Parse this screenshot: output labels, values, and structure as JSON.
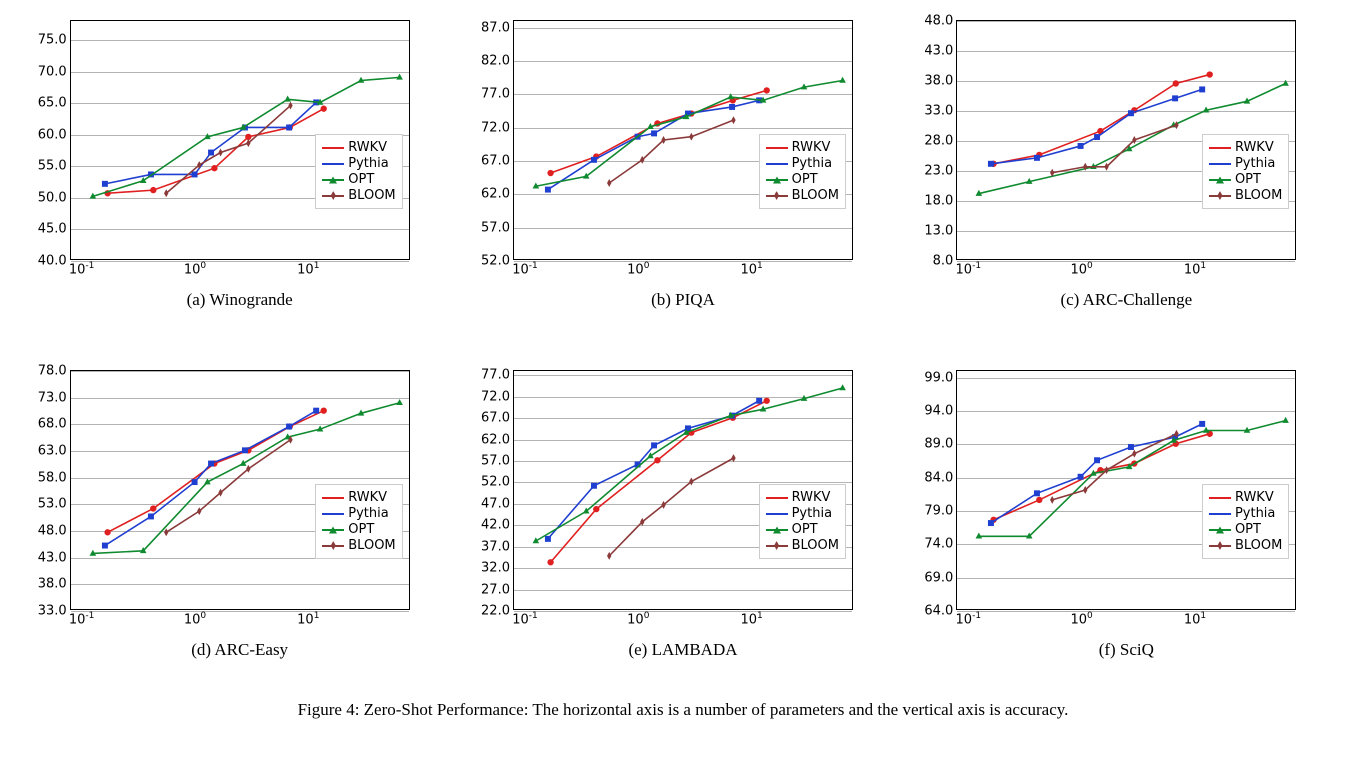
{
  "caption": "Figure 4: Zero-Shot Performance: The horizontal axis is a number of parameters and the vertical axis is accuracy.",
  "colors": {
    "RWKV": "#e02020",
    "Pythia": "#1f3fd0",
    "OPT": "#0f8a2f",
    "BLOOM": "#8b3a3a"
  },
  "markers": {
    "RWKV": "circle",
    "Pythia": "square",
    "OPT": "triangle",
    "BLOOM": "thin-diamond"
  },
  "legend_order": [
    "RWKV",
    "Pythia",
    "OPT",
    "BLOOM"
  ],
  "x_ticks_log": [
    -1,
    0,
    1
  ],
  "chart_data": [
    {
      "id": "winogrande",
      "subcap": "(a) Winogrande",
      "type": "line",
      "xscale": "log",
      "xlim": [
        0.08,
        80
      ],
      "ylim": [
        40,
        78
      ],
      "yticks": [
        40,
        45,
        50,
        55,
        60,
        65,
        70,
        75
      ],
      "legend_pos": "right-mid",
      "series": {
        "RWKV": {
          "x": [
            0.169,
            0.43,
            1.5,
            3,
            7,
            14
          ],
          "y": [
            50.5,
            51.0,
            54.5,
            59.5,
            61.0,
            64.0
          ]
        },
        "Pythia": {
          "x": [
            0.16,
            0.41,
            1.0,
            1.4,
            2.8,
            6.9,
            12
          ],
          "y": [
            52.0,
            53.5,
            53.5,
            57.0,
            61.0,
            61.0,
            65.0
          ]
        },
        "OPT": {
          "x": [
            0.125,
            0.35,
            1.3,
            2.7,
            6.7,
            13,
            30,
            66
          ],
          "y": [
            50.0,
            52.5,
            59.5,
            61.0,
            65.5,
            65.0,
            68.5,
            69.0
          ]
        },
        "BLOOM": {
          "x": [
            0.56,
            1.1,
            1.7,
            3,
            7.1
          ],
          "y": [
            50.5,
            55.0,
            57.0,
            58.5,
            64.5
          ]
        }
      }
    },
    {
      "id": "piqa",
      "subcap": "(b) PIQA",
      "type": "line",
      "xscale": "log",
      "xlim": [
        0.08,
        80
      ],
      "ylim": [
        52,
        88
      ],
      "yticks": [
        52,
        57,
        62,
        67,
        72,
        77,
        82,
        87
      ],
      "legend_pos": "right-mid",
      "series": {
        "RWKV": {
          "x": [
            0.169,
            0.43,
            1.5,
            3,
            7,
            14
          ],
          "y": [
            65.0,
            67.5,
            72.5,
            74.0,
            76.0,
            77.5
          ]
        },
        "Pythia": {
          "x": [
            0.16,
            0.41,
            1.0,
            1.4,
            2.8,
            6.9,
            12
          ],
          "y": [
            62.5,
            67.0,
            70.5,
            71.0,
            74.0,
            75.0,
            76.0
          ]
        },
        "OPT": {
          "x": [
            0.125,
            0.35,
            1.3,
            2.7,
            6.7,
            13,
            30,
            66
          ],
          "y": [
            63.0,
            64.5,
            72.0,
            73.5,
            76.5,
            76.0,
            78.0,
            79.0
          ]
        },
        "BLOOM": {
          "x": [
            0.56,
            1.1,
            1.7,
            3,
            7.1
          ],
          "y": [
            63.5,
            67.0,
            70.0,
            70.5,
            73.0
          ]
        }
      }
    },
    {
      "id": "arc-challenge",
      "subcap": "(c) ARC-Challenge",
      "type": "line",
      "xscale": "log",
      "xlim": [
        0.08,
        80
      ],
      "ylim": [
        8,
        48
      ],
      "yticks": [
        8,
        13,
        18,
        23,
        28,
        33,
        38,
        43,
        48
      ],
      "legend_pos": "right-mid",
      "series": {
        "RWKV": {
          "x": [
            0.169,
            0.43,
            1.5,
            3,
            7,
            14
          ],
          "y": [
            24.0,
            25.5,
            29.5,
            33.0,
            37.5,
            39.0
          ]
        },
        "Pythia": {
          "x": [
            0.16,
            0.41,
            1.0,
            1.4,
            2.8,
            6.9,
            12
          ],
          "y": [
            24.0,
            25.0,
            27.0,
            28.5,
            32.5,
            35.0,
            36.5
          ]
        },
        "OPT": {
          "x": [
            0.125,
            0.35,
            1.3,
            2.7,
            6.7,
            13,
            30,
            66
          ],
          "y": [
            19.0,
            21.0,
            23.5,
            26.5,
            30.5,
            33.0,
            34.5,
            37.5
          ]
        },
        "BLOOM": {
          "x": [
            0.56,
            1.1,
            1.7,
            3,
            7.1
          ],
          "y": [
            22.5,
            23.5,
            23.5,
            28.0,
            30.5
          ]
        }
      }
    },
    {
      "id": "arc-easy",
      "subcap": "(d) ARC-Easy",
      "type": "line",
      "xscale": "log",
      "xlim": [
        0.08,
        80
      ],
      "ylim": [
        33,
        78
      ],
      "yticks": [
        33,
        38,
        43,
        48,
        53,
        58,
        63,
        68,
        73,
        78
      ],
      "legend_pos": "right-mid",
      "series": {
        "RWKV": {
          "x": [
            0.169,
            0.43,
            1.5,
            3,
            7,
            14
          ],
          "y": [
            47.5,
            52.0,
            60.5,
            63.0,
            67.5,
            70.5
          ]
        },
        "Pythia": {
          "x": [
            0.16,
            0.41,
            1.0,
            1.4,
            2.8,
            6.9,
            12
          ],
          "y": [
            45.0,
            50.5,
            57.0,
            60.5,
            63.0,
            67.5,
            70.5
          ]
        },
        "OPT": {
          "x": [
            0.125,
            0.35,
            1.3,
            2.7,
            6.7,
            13,
            30,
            66
          ],
          "y": [
            43.5,
            44.0,
            57.0,
            60.5,
            65.5,
            67.0,
            70.0,
            72.0
          ]
        },
        "BLOOM": {
          "x": [
            0.56,
            1.1,
            1.7,
            3,
            7.1
          ],
          "y": [
            47.5,
            51.5,
            55.0,
            59.5,
            65.0
          ]
        }
      }
    },
    {
      "id": "lambada",
      "subcap": "(e) LAMBADA",
      "type": "line",
      "xscale": "log",
      "xlim": [
        0.08,
        80
      ],
      "ylim": [
        22,
        78
      ],
      "yticks": [
        22,
        27,
        32,
        37,
        42,
        47,
        52,
        57,
        62,
        67,
        72,
        77
      ],
      "legend_pos": "right-mid",
      "series": {
        "RWKV": {
          "x": [
            0.169,
            0.43,
            1.5,
            3,
            7,
            14
          ],
          "y": [
            33.0,
            45.5,
            57.0,
            63.5,
            67.0,
            71.0
          ]
        },
        "Pythia": {
          "x": [
            0.16,
            0.41,
            1.0,
            1.4,
            2.8,
            6.9,
            12
          ],
          "y": [
            38.5,
            51.0,
            56.0,
            60.5,
            64.5,
            67.5,
            71.0
          ]
        },
        "OPT": {
          "x": [
            0.125,
            0.35,
            1.3,
            2.7,
            6.7,
            13,
            30,
            66
          ],
          "y": [
            38.0,
            45.0,
            58.0,
            63.5,
            67.5,
            69.0,
            71.5,
            74.0
          ]
        },
        "BLOOM": {
          "x": [
            0.56,
            1.1,
            1.7,
            3,
            7.1
          ],
          "y": [
            34.5,
            42.5,
            46.5,
            52.0,
            57.5
          ]
        }
      }
    },
    {
      "id": "sciq",
      "subcap": "(f) SciQ",
      "type": "line",
      "xscale": "log",
      "xlim": [
        0.08,
        80
      ],
      "ylim": [
        64,
        100
      ],
      "yticks": [
        64,
        69,
        74,
        79,
        84,
        89,
        94,
        99
      ],
      "legend_pos": "right-mid",
      "series": {
        "RWKV": {
          "x": [
            0.169,
            0.43,
            1.5,
            3,
            7,
            14
          ],
          "y": [
            77.5,
            80.5,
            85.0,
            86.0,
            89.0,
            90.5
          ]
        },
        "Pythia": {
          "x": [
            0.16,
            0.41,
            1.0,
            1.4,
            2.8,
            6.9,
            12
          ],
          "y": [
            77.0,
            81.5,
            84.0,
            86.5,
            88.5,
            90.0,
            92.0
          ]
        },
        "OPT": {
          "x": [
            0.125,
            0.35,
            1.3,
            2.7,
            6.7,
            13,
            30,
            66
          ],
          "y": [
            75.0,
            75.0,
            84.5,
            85.5,
            89.5,
            91.0,
            91.0,
            92.5
          ]
        },
        "BLOOM": {
          "x": [
            0.56,
            1.1,
            1.7,
            3,
            7.1
          ],
          "y": [
            80.5,
            82.0,
            85.0,
            87.5,
            90.5
          ]
        }
      }
    }
  ]
}
